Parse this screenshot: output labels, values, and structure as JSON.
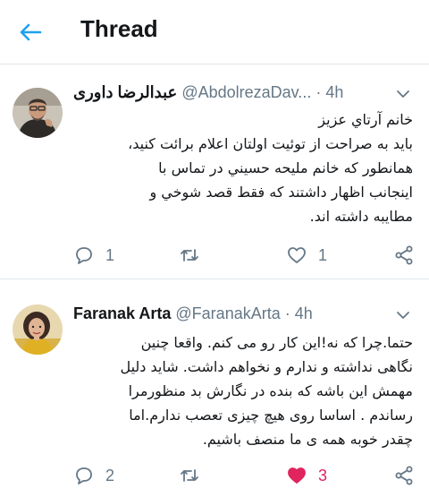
{
  "header": {
    "title": "Thread"
  },
  "colors": {
    "accent": "#1da1f2",
    "muted": "#657786",
    "like": "#e0245e",
    "divider": "#e1e8ed"
  },
  "tweets": [
    {
      "name": "عبدالرضا داوری",
      "handle": "@AbdolrezaDav...",
      "dot": "·",
      "time": "4h",
      "lines": [
        "خانم آرتاي عزيز",
        "بايد به صراحت از توئيت اولتان اعلام برائت كنيد،",
        "همانطور كه خانم مليحه حسيني در تماس با",
        "اينجانب اظهار داشتند كه فقط قصد شوخي و",
        "مطايبه داشته اند."
      ],
      "reply_count": "1",
      "retweet_count": "",
      "like_count": "1",
      "liked": false
    },
    {
      "name": "Faranak Arta",
      "handle": "@FaranakArta",
      "dot": "·",
      "time": "4h",
      "lines": [
        "حتما.چرا که نه!این کار رو می کنم. واقعا چنین",
        "نگاهی نداشته و ندارم و نخواهم داشت. شاید دلیل",
        "مهمش  این باشه که بنده در نگارش بد منظورمرا",
        "رساندم . اساسا روی هیچ چیزی تعصب ندارم.اما",
        "چقدر خوبه همه ی ما منصف باشیم."
      ],
      "reply_count": "2",
      "retweet_count": "",
      "like_count": "3",
      "liked": true
    }
  ]
}
